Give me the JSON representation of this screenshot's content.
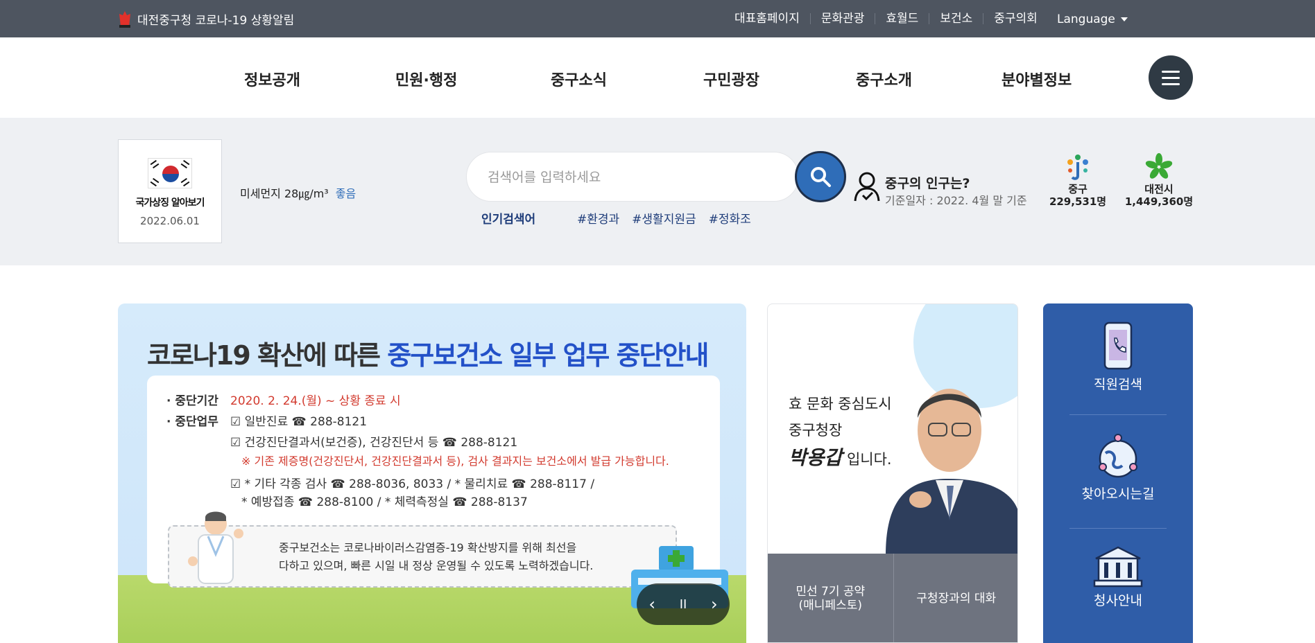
{
  "topbar": {
    "alert": "대전중구청 코로나-19 상황알림",
    "links": [
      "대표홈페이지",
      "문화관광",
      "효월드",
      "보건소",
      "중구의회"
    ],
    "language": "Language"
  },
  "gnb": [
    "정보공개",
    "민원·행정",
    "중구소식",
    "구민광장",
    "중구소개",
    "분야별정보"
  ],
  "flag": {
    "title": "국가상징 알아보기",
    "date": "2022.06.01"
  },
  "dust": {
    "label": "미세먼지 28㎍/m³",
    "status": "좋음"
  },
  "search": {
    "placeholder": "검색어를 입력하세요",
    "popular_label": "인기검색어",
    "tags": [
      "#환경과",
      "#생활지원금",
      "#정화조"
    ]
  },
  "population": {
    "title": "중구의 인구는?",
    "subtitle": "기준일자 : 2022. 4월 말 기준",
    "junggu_name": "중구",
    "junggu_count": "229,531명",
    "daejeon_name": "대전시",
    "daejeon_count": "1,449,360명"
  },
  "banner": {
    "title_plain": "코로나19 확산에 따른 ",
    "title_highlight": "중구보건소 일부 업무 중단안내",
    "period_label": "· 중단기간",
    "period_value": "2020. 2. 24.(월) ~ 상황 종료 시",
    "work_label": "· 중단업무",
    "work1": "☑ 일반진료 ☎ 288-8121",
    "work2": "☑ 건강진단결과서(보건증), 건강진단서 등 ☎ 288-8121",
    "work2_note": "※ 기존 제증명(건강진단서, 건강진단결과서 등), 검사 결과지는 보건소에서 발급 가능합니다.",
    "work3": "☑ * 기타 각종 검사 ☎ 288-8036, 8033 / * 물리치료 ☎ 288-8117 /",
    "work3b": "* 예방접종 ☎ 288-8100 / * 체력측정실 ☎ 288-8137",
    "note_line1": "중구보건소는 코로나바이러스감염증-19 확산방지를 위해 최선을",
    "note_line2": "다하고 있으며, 빠른 시일 내 정상 운영될 수 있도록 노력하겠습니다."
  },
  "mayor": {
    "line1": "효 문화 중심도시",
    "line2": "중구청장",
    "name": "박용갑",
    "suffix": "입니다.",
    "link1_a": "민선 7기 공약",
    "link1_b": "(매니페스토)",
    "link2": "구청장과의 대화"
  },
  "quick": [
    "직원검색",
    "찾아오시는길",
    "청사안내"
  ],
  "colors": {
    "topbar": "#4e5560",
    "accent": "#2f6db8",
    "quick": "#2f5da8",
    "banner_highlight": "#2351c8"
  }
}
